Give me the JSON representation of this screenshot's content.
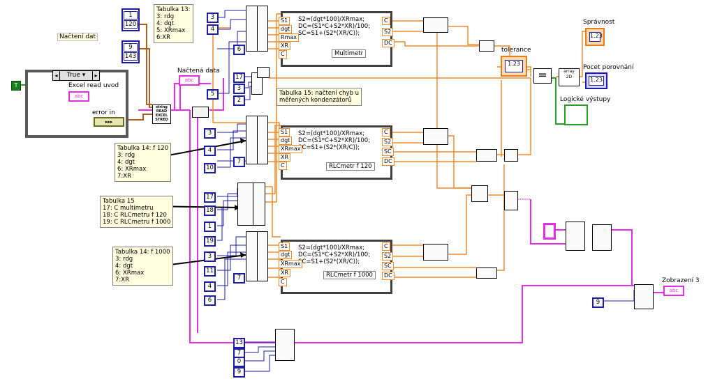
{
  "labels": {
    "nacteni_dat": "Načtení dat",
    "excel_read_uvod": "Excel read uvod",
    "error_in": "error in",
    "nactena_data": "Načtená data",
    "tolerance": "tolerance",
    "spravnost": "Správnost",
    "pocet_porovnani": "Pocet porovnání",
    "logicke_vystupy": "Logické výstupy",
    "zobrazeni_3": "Zobrazení 3",
    "case_selector": "True",
    "true_const": "T"
  },
  "notes": {
    "tab13": "Tabulka 13:\n3: rdg\n4: dgt\n5: XRmax\n6:XR",
    "tab14_120": "Tabulka 14: f 120\n3: rdg\n4: dgt\n6: XRmax\n7:XR",
    "tab15": "Tabulka 15\n17: C multimetru\n18: C RLCmetru f 120\n19: C RLCmetru f 1000",
    "tab15_chyb": "Tabulka 15: načtení chyb u\nměřených kondenzátorů",
    "tab14_1000": "Tabulka 14: f 1000\n3: rdg\n4: dgt\n6: XRmax\n7:XR"
  },
  "formulas": [
    {
      "text": "S2=(dgt*100)/XRmax;\nDC=(S1*C+S2*XR)/100;\nSC=S1+(S2*(XR/C));",
      "name": "Multimetr",
      "inputs": [
        "S1",
        "dgt",
        "Rmax",
        "XR",
        "C"
      ],
      "outputs": [
        "C",
        "S2",
        "DC"
      ]
    },
    {
      "text": "S2=(dgt*100)/XRmax;\nDC=(S1*C+S2*XR)/100;\nSC=S1+(S2*(XR/C));",
      "name": "RLCmetr f 120",
      "inputs": [
        "S1",
        "dgt",
        "XRmax",
        "XR",
        "C"
      ],
      "outputs": [
        "C",
        "S2",
        "SC",
        "DC"
      ]
    },
    {
      "text": "S2=(dgt*100)/XRmax;\nDC=(S1*C+S2*XR)/100;\nSC=S1+(S2*(XR/C));",
      "name": "RLCmetr f 1000",
      "inputs": [
        "S1",
        "dgt",
        "XRmax",
        "XR",
        "C"
      ],
      "outputs": [
        "C",
        "S2",
        "SC",
        "DC"
      ]
    }
  ],
  "constants": {
    "arr1": [
      "1",
      "120"
    ],
    "arr2": [
      "9",
      "143"
    ],
    "c_top": [
      "3",
      "4",
      "6",
      "5"
    ],
    "c_17": "17",
    "c_3b": "3",
    "c_2": "2",
    "c_mid": [
      "3",
      "4",
      "10",
      "7",
      "17",
      "18",
      "1",
      "19"
    ],
    "c_low": [
      "3",
      "3",
      "11",
      "4",
      "6",
      "7"
    ],
    "c_bottom": [
      "13",
      "7",
      "0",
      "9"
    ],
    "c_9": "9"
  },
  "indicators": {
    "num": "1.23",
    "str": "abc",
    "read_vi": "string\nREAD\nEXCEL\nSTRED",
    "array2d": "array\n2D"
  }
}
